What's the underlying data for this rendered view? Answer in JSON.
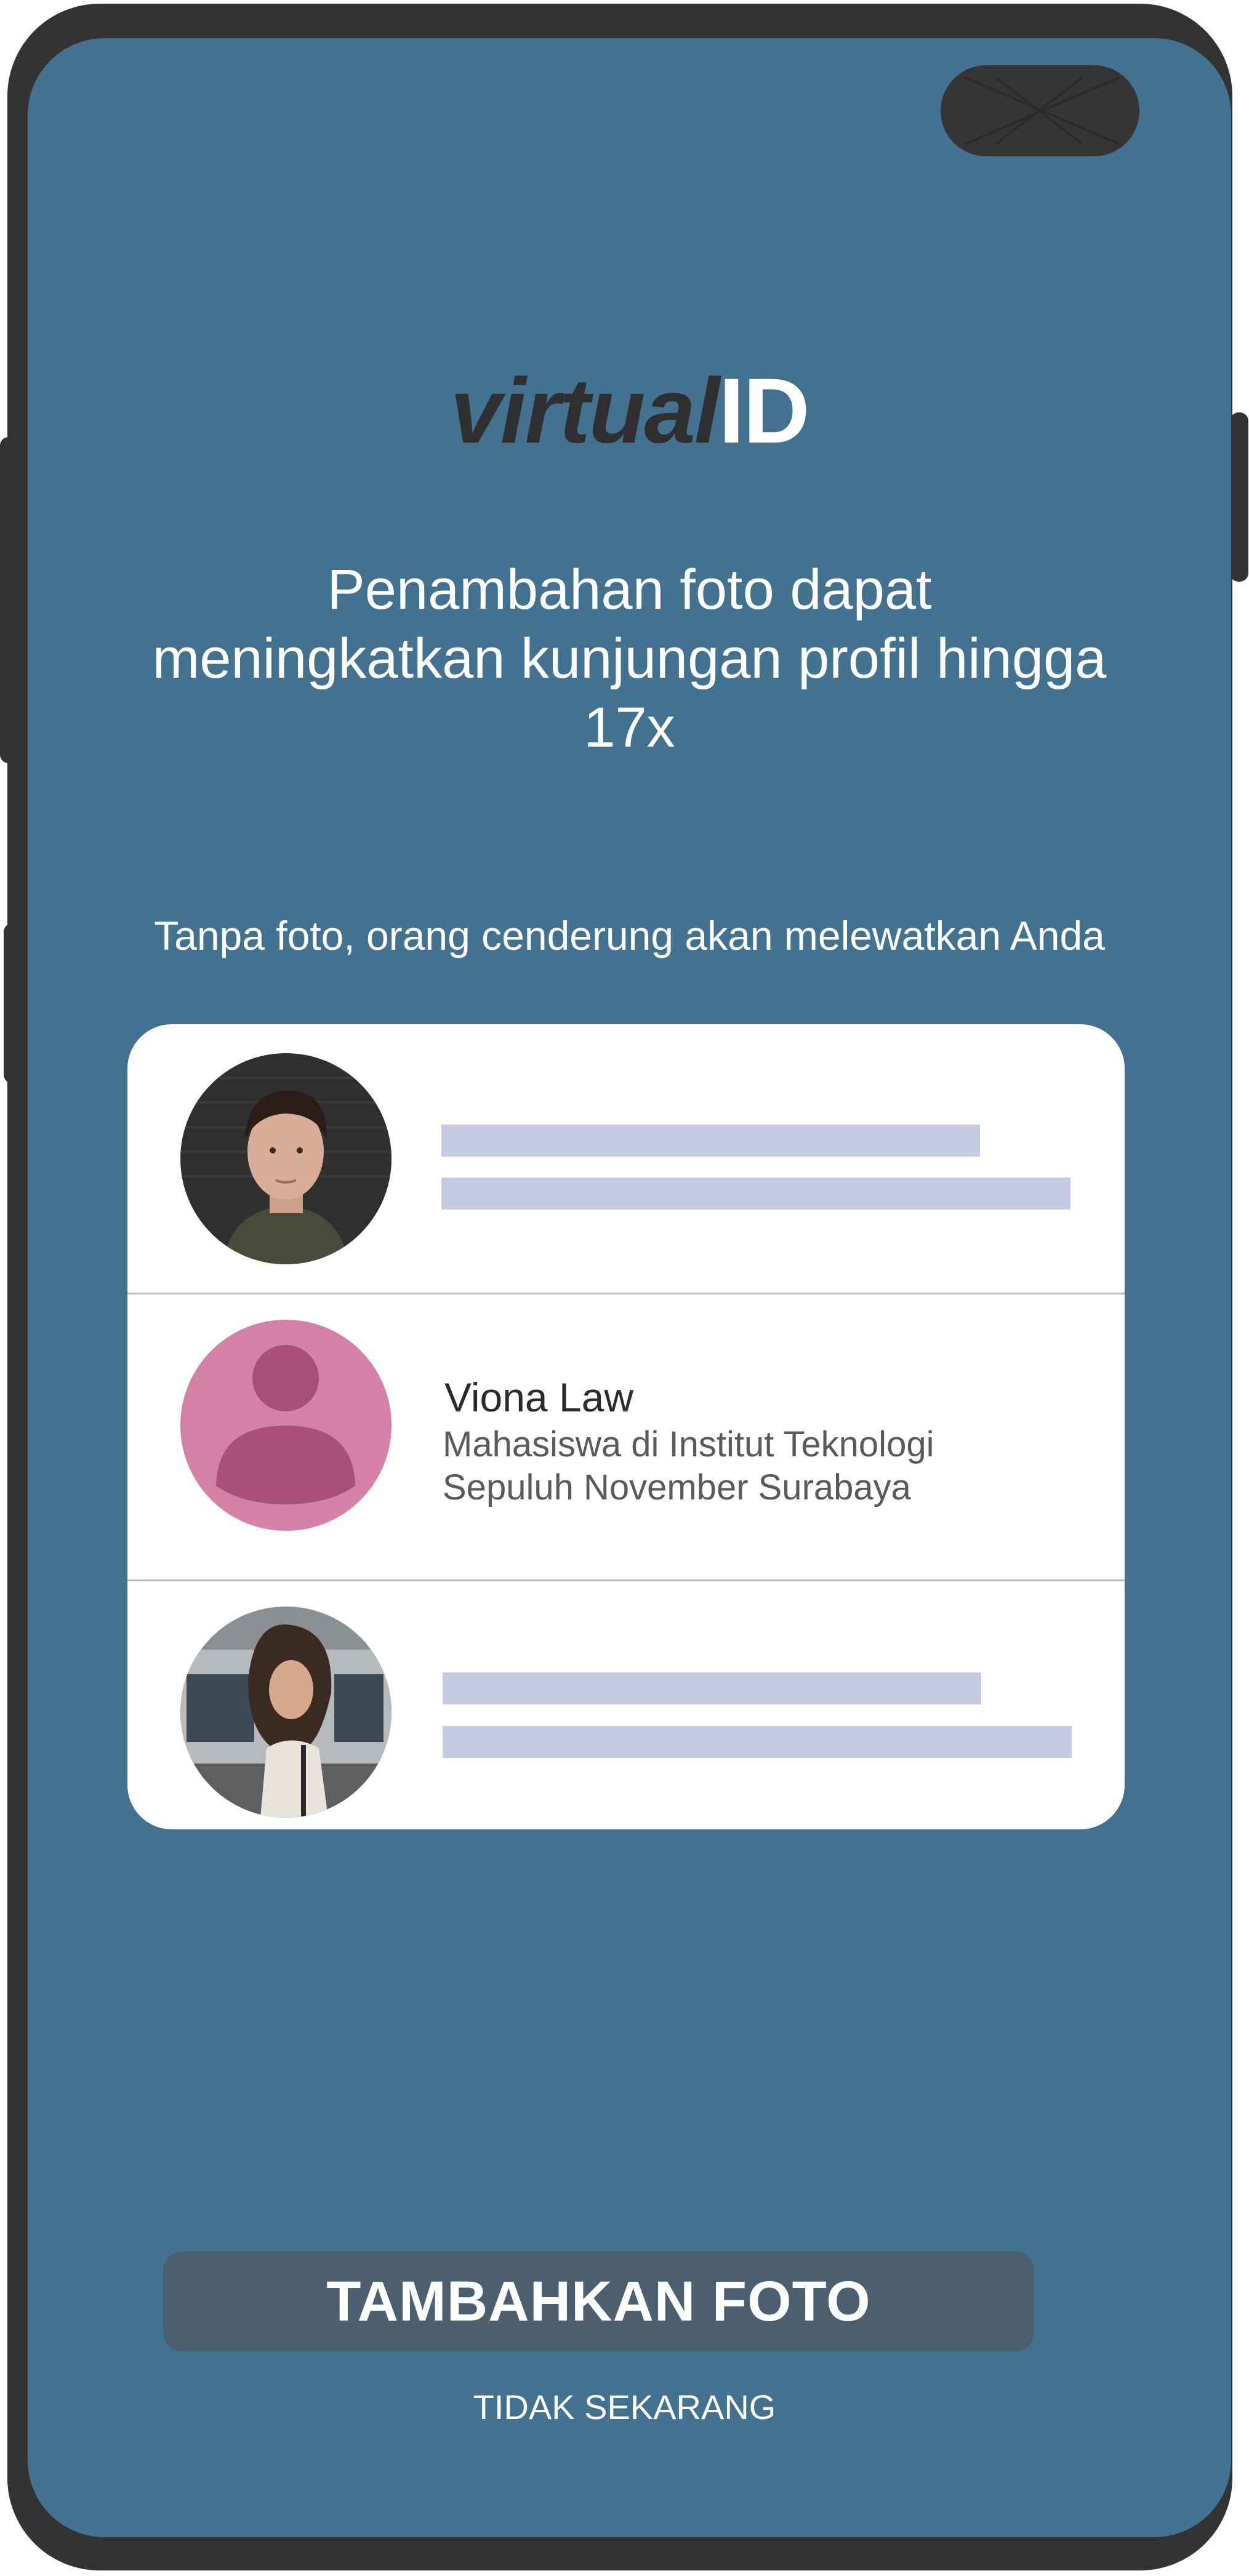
{
  "app": {
    "logo_part1": "virtual",
    "logo_part2": "ID"
  },
  "content": {
    "headline": "Penambahan foto dapat meningkatkan kunjungan profil hingga 17x",
    "subline": "Tanpa foto, orang cenderung akan melewatkan Anda"
  },
  "profile_card": {
    "profiles": [
      {
        "type": "photo",
        "avatar_icon": "man-portrait-photo",
        "placeholder": true
      },
      {
        "type": "default-avatar",
        "avatar_icon": "user-silhouette-icon",
        "name": "Viona Law",
        "description": "Mahasiswa di Institut Teknologi Sepuluh November Surabaya"
      },
      {
        "type": "photo",
        "avatar_icon": "woman-portrait-photo",
        "placeholder": true
      }
    ]
  },
  "actions": {
    "primary_label": "TAMBAHKAN FOTO",
    "secondary_label": "TIDAK SEKARANG"
  },
  "colors": {
    "screen_bg": "#437291",
    "frame": "#333333",
    "card_bg": "#ffffff",
    "placeholder_bar": "#c5cbe2",
    "avatar_pink": "#d580a6",
    "avatar_dark_pink": "#a8507a",
    "button_bg": "#4c5f6f"
  }
}
